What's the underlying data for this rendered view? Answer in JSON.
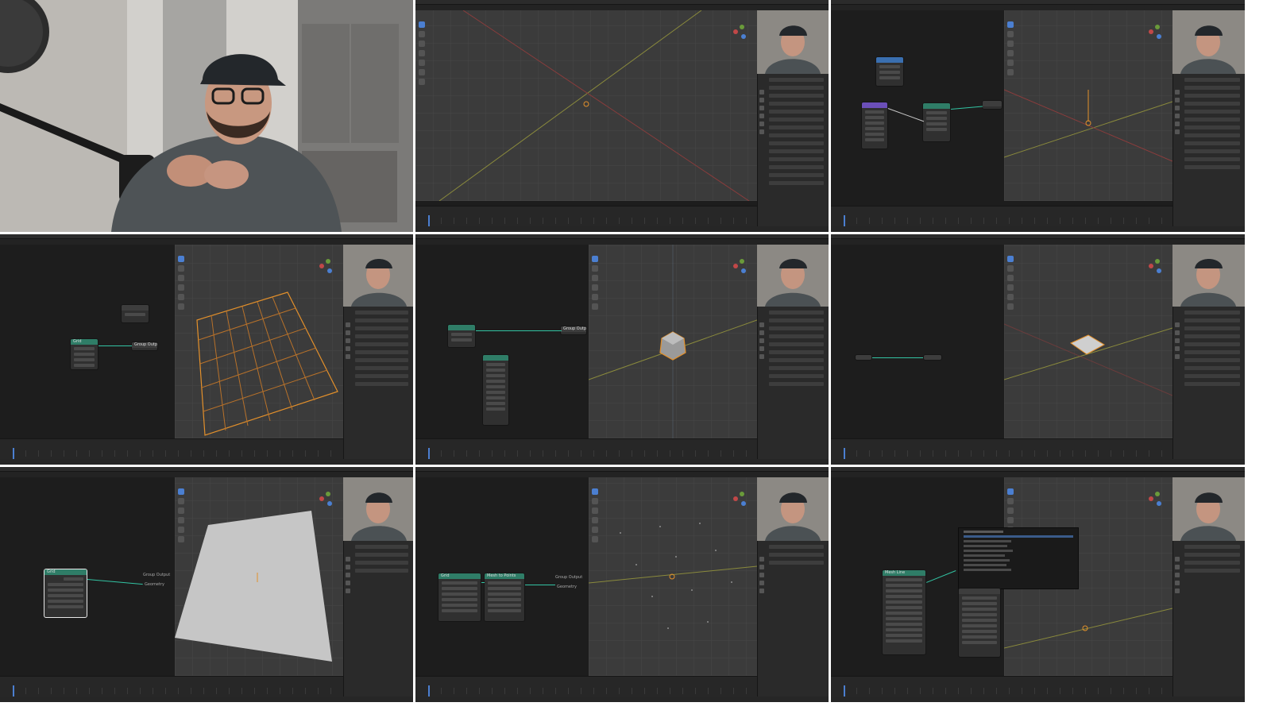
{
  "collage": {
    "panels": [
      {
        "type": "camera",
        "description": ""
      },
      {
        "type": "blender",
        "view": "empty-scene",
        "node_editor": false
      },
      {
        "type": "blender",
        "view": "node-graph",
        "node_editor": true
      },
      {
        "type": "blender",
        "view": "grid-mesh",
        "node_editor": true
      },
      {
        "type": "blender",
        "view": "ico-sphere",
        "node_editor": true
      },
      {
        "type": "blender",
        "view": "small-plane",
        "node_editor": true
      },
      {
        "type": "blender",
        "view": "large-plane",
        "node_editor": true
      },
      {
        "type": "blender",
        "view": "points",
        "node_editor": true
      },
      {
        "type": "blender",
        "view": "search-menu",
        "node_editor": true
      }
    ]
  },
  "node_labels": {
    "group_output": "Group Output",
    "geometry": "Geometry",
    "grid": "Grid",
    "mesh": "Mesh",
    "mesh_to_points": "Mesh to Points",
    "points": "Points",
    "mesh_line": "Mesh Line"
  },
  "colors": {
    "blender_bg": "#1d1d1d",
    "viewport": "#3b3b3b",
    "geometry_node_header": "#2f7d67",
    "wire": "#32c4a3",
    "selection_orange": "#e3902b",
    "active_blue": "#4b7fd1"
  }
}
